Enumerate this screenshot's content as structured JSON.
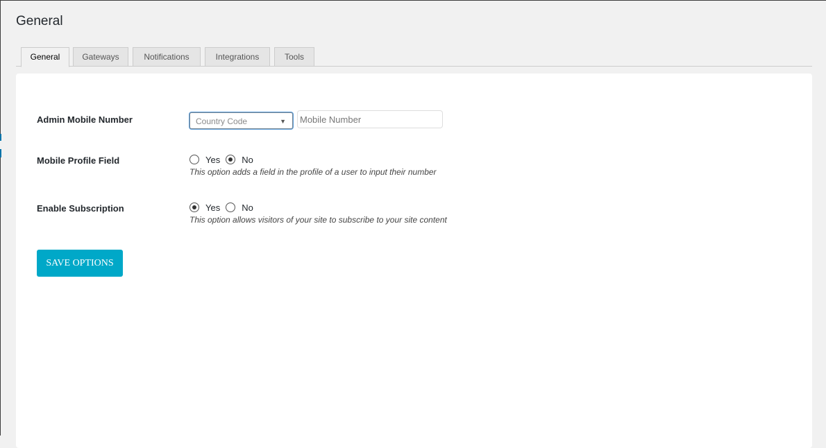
{
  "page": {
    "title": "General"
  },
  "tabs": [
    {
      "label": "General",
      "active": true
    },
    {
      "label": "Gateways",
      "active": false
    },
    {
      "label": "Notifications",
      "active": false
    },
    {
      "label": "Integrations",
      "active": false
    },
    {
      "label": "Tools",
      "active": false
    }
  ],
  "form": {
    "admin_mobile": {
      "label": "Admin Mobile Number",
      "country_code_value": "Country Code",
      "mobile_placeholder": "Mobile Number"
    },
    "mobile_profile_field": {
      "label": "Mobile Profile Field",
      "yes_label": "Yes",
      "no_label": "No",
      "selected": "No",
      "description": "This option adds a field in the profile of a user to input their number"
    },
    "enable_subscription": {
      "label": "Enable Subscription",
      "yes_label": "Yes",
      "no_label": "No",
      "selected": "Yes",
      "description": "This option allows visitors of your site to subscribe to your site content"
    },
    "save_label": "SAVE OPTIONS"
  },
  "icons": {
    "select_caret": "chevron-down-icon"
  },
  "colors": {
    "save_button": "#00a8c8",
    "focus_ring": "#5b9dd9"
  }
}
